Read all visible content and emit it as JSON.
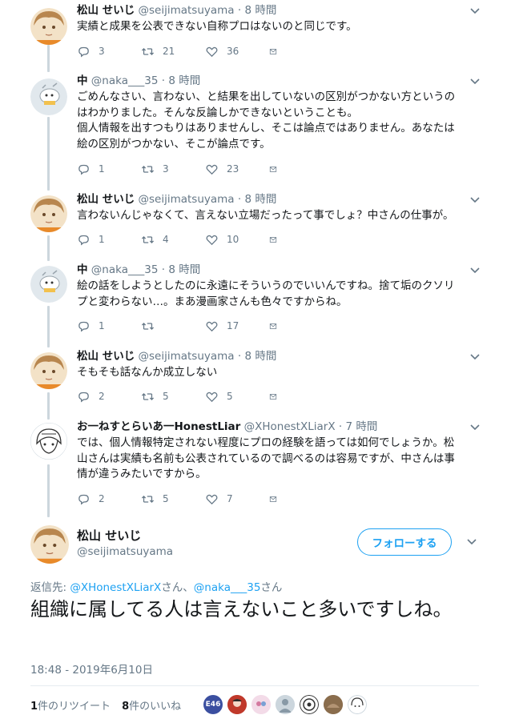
{
  "thread": [
    {
      "name": "松山 せいじ",
      "handle": "@seijimatsuyama",
      "time": "8 時間",
      "avatar": "matsuyama-avatar",
      "lines": [
        "実績と成果を公表できない自称プロはないのと同じです。"
      ],
      "replies": "3",
      "retweets": "21",
      "likes": "36"
    },
    {
      "name": "中",
      "handle": "@naka___35",
      "time": "8 時間",
      "avatar": "naka-avatar",
      "lines": [
        "ごめんなさい、言わない、と結果を出していないの区別がつかない方というの",
        "はわかりました。そんな反論しかできないということも。",
        "個人情報を出すつもりはありませんし、そこは論点ではありません。あなたは",
        "絵の区別がつかない、そこが論点です。"
      ],
      "replies": "1",
      "retweets": "3",
      "likes": "23"
    },
    {
      "name": "松山 せいじ",
      "handle": "@seijimatsuyama",
      "time": "8 時間",
      "avatar": "matsuyama-avatar",
      "lines": [
        "言わないんじゃなくて、言えない立場だったって事でしょ？中さんの仕事が。"
      ],
      "replies": "1",
      "retweets": "4",
      "likes": "10"
    },
    {
      "name": "中",
      "handle": "@naka___35",
      "time": "8 時間",
      "avatar": "naka-avatar",
      "lines": [
        "絵の話をしようとしたのに永遠にそういうのでいいんですね。捨て垢のクソリ",
        "プと変わらない…。まあ漫画家さんも色々ですからね。"
      ],
      "replies": "1",
      "retweets": "",
      "likes": "17"
    },
    {
      "name": "松山 せいじ",
      "handle": "@seijimatsuyama",
      "time": "8 時間",
      "avatar": "matsuyama-avatar",
      "lines": [
        "そもそも話なんか成立しない"
      ],
      "replies": "2",
      "retweets": "5",
      "likes": "5"
    },
    {
      "name": "お一ねすとらいあ一HonestLiar",
      "handle": "@XHonestXLiarX",
      "time": "7 時間",
      "avatar": "honestliar-avatar",
      "lines": [
        "では、個人情報特定されない程度にプロの経験を語っては如何でしょうか。松",
        "山さんは実績も名前も公表されているので調べるのは容易ですが、中さんは事",
        "情が違うみたいですから。"
      ],
      "replies": "2",
      "retweets": "5",
      "likes": "7"
    }
  ],
  "focused": {
    "name": "松山 せいじ",
    "handle": "@seijimatsuyama",
    "follow_label": "フォローする",
    "reply_prefix": "返信先: ",
    "reply_user1": "@XHonestXLiarX",
    "reply_mid": "さん、",
    "reply_user2": "@naka___35",
    "reply_suffix": "さん",
    "text": "組織に属してる人は言えないこと多いですしね。",
    "timestamp": "18:48 - 2019年6月10日",
    "retweet_count": "1",
    "retweet_label": "件のリツイート",
    "like_count": "8",
    "like_label": "件のいいね",
    "likers": [
      "E46",
      "",
      "",
      "",
      "",
      "",
      ""
    ]
  },
  "colors": {
    "accent": "#1da1f2",
    "muted": "#657786",
    "thread_line": "#ccd6dd"
  }
}
